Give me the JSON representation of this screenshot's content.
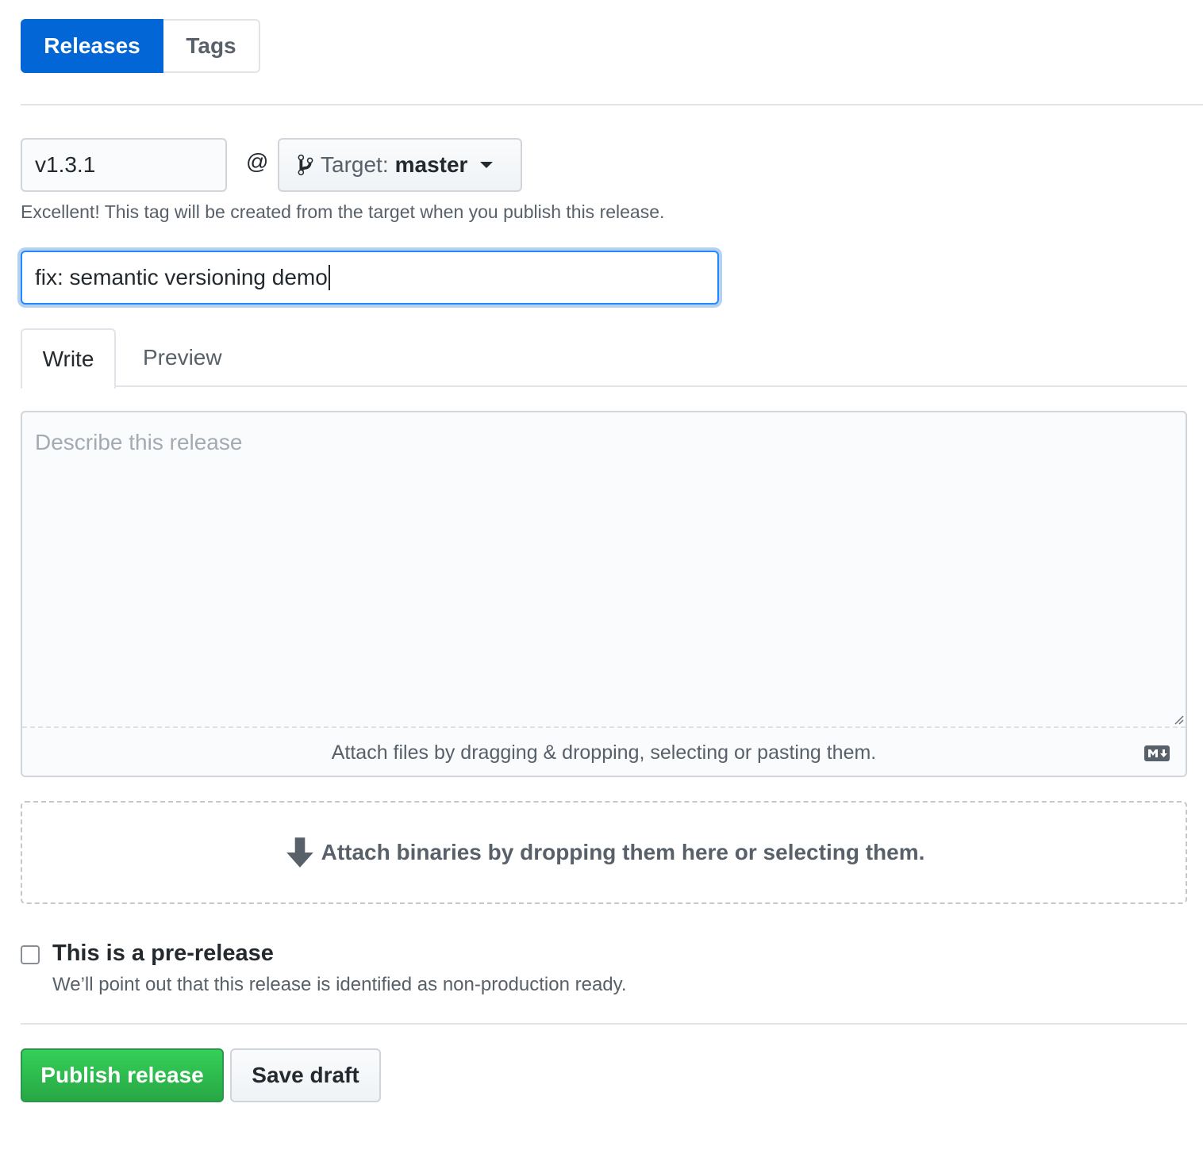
{
  "subnav": {
    "releases_label": "Releases",
    "tags_label": "Tags"
  },
  "tag": {
    "value": "v1.3.1",
    "at_symbol": "@",
    "target_prefix": "Target:",
    "target_branch": "master",
    "hint": "Excellent! This tag will be created from the target when you publish this release."
  },
  "release_title": {
    "value": "fix: semantic versioning demo"
  },
  "editor_tabs": {
    "write_label": "Write",
    "preview_label": "Preview"
  },
  "editor": {
    "placeholder": "Describe this release",
    "attach_text": "Attach files by dragging & dropping, selecting or pasting them."
  },
  "binaries": {
    "text": "Attach binaries by dropping them here or selecting them."
  },
  "prerelease": {
    "label": "This is a pre-release",
    "note": "We’ll point out that this release is identified as non-production ready.",
    "checked": false
  },
  "actions": {
    "publish_label": "Publish release",
    "draft_label": "Save draft"
  },
  "colors": {
    "accent": "#0366d6",
    "focus": "#2188ff",
    "publish": "#28a745"
  }
}
